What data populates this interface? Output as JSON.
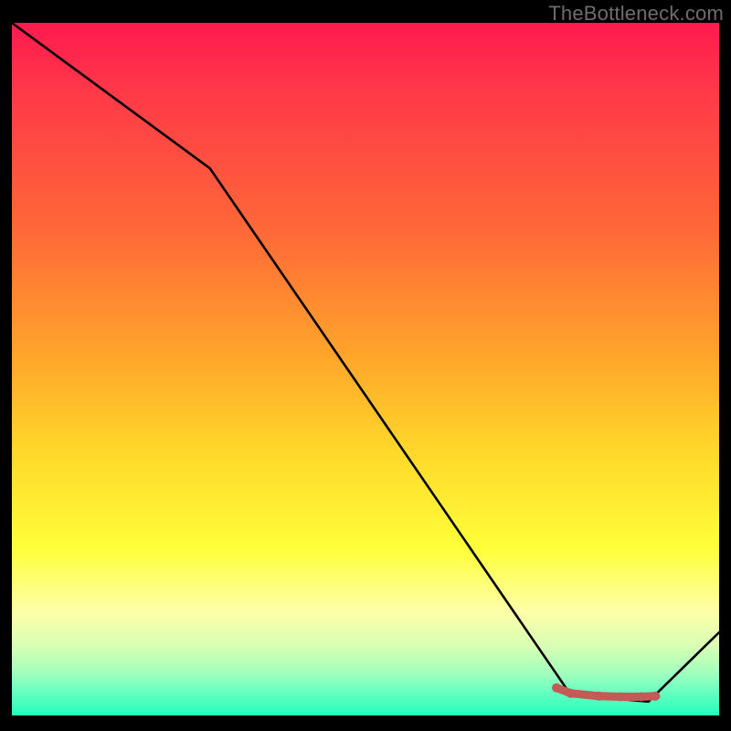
{
  "watermark": "TheBottleneck.com",
  "chart_data": {
    "type": "line",
    "title": "",
    "xlabel": "",
    "ylabel": "",
    "xlim": [
      0,
      100
    ],
    "ylim": [
      0,
      100
    ],
    "series": [
      {
        "name": "black-line",
        "color": "#000000",
        "x": [
          0,
          28,
          79,
          90,
          100
        ],
        "y": [
          100,
          79,
          3,
          2,
          12
        ]
      },
      {
        "name": "red-line",
        "color": "#c45a55",
        "x": [
          77,
          79,
          83,
          86,
          89,
          91
        ],
        "y": [
          4.0,
          3.2,
          2.8,
          2.7,
          2.7,
          2.8
        ]
      }
    ],
    "gradient_stops": [
      {
        "pos": 0,
        "color": "#ff1a4f"
      },
      {
        "pos": 11,
        "color": "#ff3b47"
      },
      {
        "pos": 30,
        "color": "#ff6838"
      },
      {
        "pos": 48,
        "color": "#ffa52a"
      },
      {
        "pos": 62,
        "color": "#ffd82a"
      },
      {
        "pos": 76,
        "color": "#ffff3a"
      },
      {
        "pos": 85,
        "color": "#fdffa8"
      },
      {
        "pos": 90,
        "color": "#d8ffb4"
      },
      {
        "pos": 94,
        "color": "#a0ffbe"
      },
      {
        "pos": 97,
        "color": "#5fffc1"
      },
      {
        "pos": 100,
        "color": "#22ffbb"
      }
    ]
  }
}
